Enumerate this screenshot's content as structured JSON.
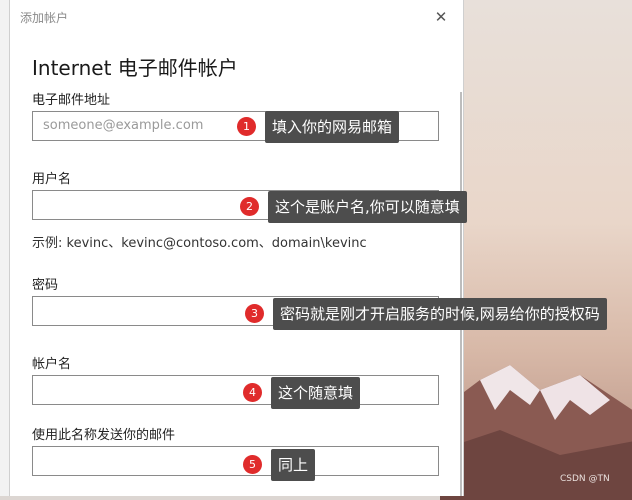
{
  "window": {
    "title": "添加帐户"
  },
  "heading": "Internet 电子邮件帐户",
  "fields": {
    "email": {
      "label": "电子邮件地址",
      "placeholder": "someone@example.com"
    },
    "username": {
      "label": "用户名",
      "hint": "示例: kevinc、kevinc@contoso.com、domain\\kevinc"
    },
    "password": {
      "label": "密码"
    },
    "account_name": {
      "label": "帐户名"
    },
    "sender_name": {
      "label": "使用此名称发送你的邮件"
    }
  },
  "annotations": [
    {
      "num": "1",
      "text": "填入你的网易邮箱"
    },
    {
      "num": "2",
      "text": "这个是账户名,你可以随意填"
    },
    {
      "num": "3",
      "text": "密码就是刚才开启服务的时候,网易给你的授权码"
    },
    {
      "num": "4",
      "text": "这个随意填"
    },
    {
      "num": "5",
      "text": "同上"
    }
  ],
  "watermark": "CSDN @TN",
  "colors": {
    "badge": "#e02b2b",
    "callout": "#4d4d4d"
  }
}
